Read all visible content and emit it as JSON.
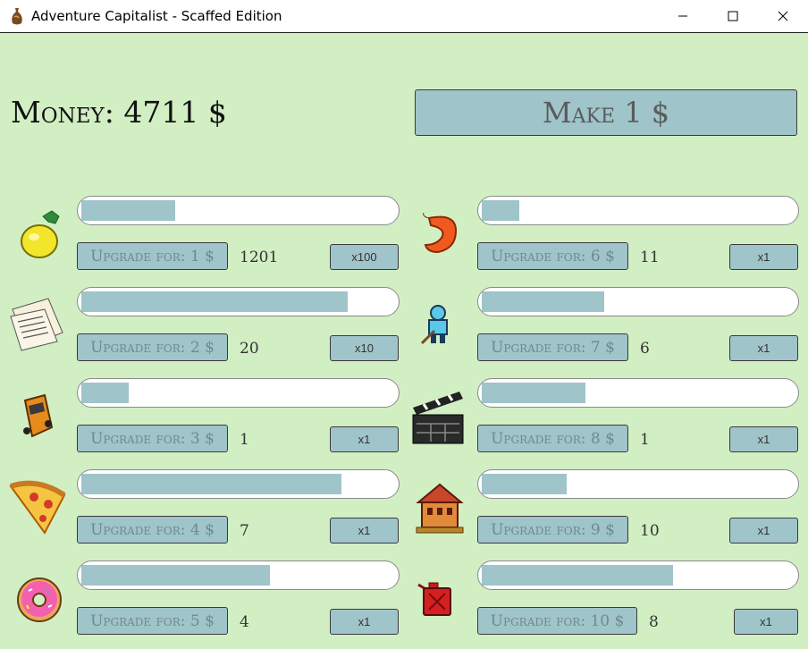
{
  "window": {
    "title": "Adventure Capitalist - Scaffed Edition",
    "icon": "money-bag-icon"
  },
  "money": {
    "label": "Money: 4711 $"
  },
  "make_button": {
    "label": "Make 1 $"
  },
  "businesses": [
    {
      "icon": "lemon-icon",
      "progress": 0.3,
      "upgrade_label": "Upgrade for: 1 $",
      "count": "1201",
      "multiplier": "x100"
    },
    {
      "icon": "newspaper-icon",
      "progress": 0.85,
      "upgrade_label": "Upgrade for: 2 $",
      "count": "20",
      "multiplier": "x10"
    },
    {
      "icon": "car-icon",
      "progress": 0.15,
      "upgrade_label": "Upgrade for: 3 $",
      "count": "1",
      "multiplier": "x1"
    },
    {
      "icon": "pizza-icon",
      "progress": 0.83,
      "upgrade_label": "Upgrade for: 4 $",
      "count": "7",
      "multiplier": "x1"
    },
    {
      "icon": "donut-icon",
      "progress": 0.6,
      "upgrade_label": "Upgrade for: 5 $",
      "count": "4",
      "multiplier": "x1"
    },
    {
      "icon": "shrimp-icon",
      "progress": 0.12,
      "upgrade_label": "Upgrade for: 6 $",
      "count": "11",
      "multiplier": "x1"
    },
    {
      "icon": "hockey-player-icon",
      "progress": 0.39,
      "upgrade_label": "Upgrade for: 7 $",
      "count": "6",
      "multiplier": "x1"
    },
    {
      "icon": "clapperboard-icon",
      "progress": 0.33,
      "upgrade_label": "Upgrade for: 8 $",
      "count": "1",
      "multiplier": "x1"
    },
    {
      "icon": "bank-building-icon",
      "progress": 0.27,
      "upgrade_label": "Upgrade for: 9 $",
      "count": "10",
      "multiplier": "x1"
    },
    {
      "icon": "oil-can-icon",
      "progress": 0.61,
      "upgrade_label": "Upgrade for: 10 $",
      "count": "8",
      "multiplier": "x1"
    }
  ],
  "colors": {
    "background": "#d2efc4",
    "accent": "#9fc4ca"
  }
}
